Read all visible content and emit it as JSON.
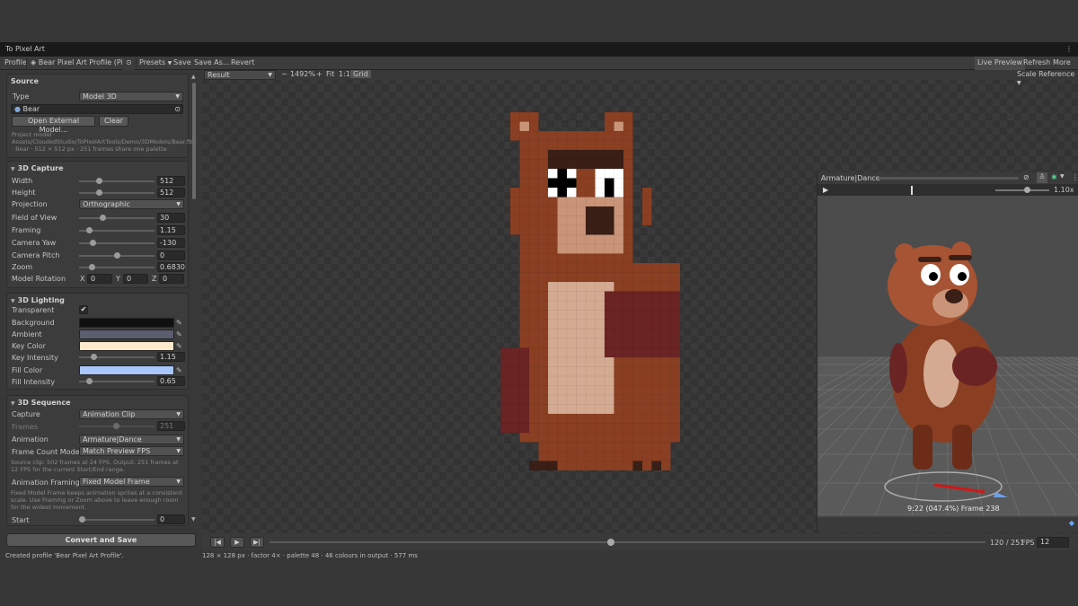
{
  "window": {
    "title": "To Pixel Art",
    "menu_icon": "vertical-dots-icon"
  },
  "toolbar": {
    "profile_label": "Profile",
    "profile_name": "Bear Pixel Art Profile (Pixel",
    "presets": "Presets",
    "save": "Save",
    "save_as": "Save As...",
    "revert": "Revert",
    "live_preview": "Live Preview",
    "refresh": "Refresh",
    "more": "More"
  },
  "source": {
    "title": "Source",
    "type_label": "Type",
    "type_value": "Model 3D",
    "model_value": "Bear",
    "open_external": "Open External Model...",
    "clear": "Clear",
    "info": "Project model · Assets/CloudedStudio/ToPixelArtTools/Demo/3DModels/Bear.fbx · Bear · 512 × 512 px · 251 frames share one palette"
  },
  "capture": {
    "title": "3D Capture",
    "rows": [
      {
        "label": "Width",
        "value": "512",
        "level": 0.25
      },
      {
        "label": "Height",
        "value": "512",
        "level": 0.25
      },
      {
        "label": "Field of View",
        "value": "30",
        "level": 0.3
      },
      {
        "label": "Framing",
        "value": "1.15",
        "level": 0.1
      },
      {
        "label": "Camera Yaw",
        "value": "-130",
        "level": 0.15
      },
      {
        "label": "Camera Pitch",
        "value": "0",
        "level": 0.5
      },
      {
        "label": "Zoom",
        "value": "0.6830",
        "level": 0.14
      }
    ],
    "projection_label": "Projection",
    "projection_value": "Orthographic",
    "rotation_label": "Model Rotation",
    "rot_x_label": "X",
    "rot_x": "0",
    "rot_y_label": "Y",
    "rot_y": "0",
    "rot_z_label": "Z",
    "rot_z": "0"
  },
  "lighting": {
    "title": "3D Lighting",
    "transparent_label": "Transparent",
    "transparent_checked": true,
    "colors": [
      {
        "label": "Background",
        "color": "#101010"
      },
      {
        "label": "Ambient",
        "color": "#5a5e6e"
      },
      {
        "label": "Key Color",
        "color": "#fde9cc"
      },
      {
        "label": "Fill Color",
        "color": "#a9c7fa"
      }
    ],
    "key_intensity_label": "Key Intensity",
    "key_intensity": "1.15",
    "key_level": 0.17,
    "fill_intensity_label": "Fill Intensity",
    "fill_intensity": "0.65",
    "fill_level": 0.1
  },
  "sequence": {
    "title": "3D Sequence",
    "capture_label": "Capture",
    "capture_value": "Animation Clip",
    "frames_label": "Frames",
    "frames_value": "251",
    "animation_label": "Animation",
    "animation_value": "Armature|Dance",
    "frame_count_label": "Frame Count Mode",
    "frame_count_value": "Match Preview FPS",
    "info1": "Source clip: 502 frames at 24 FPS. Output: 251 frames at 12 FPS for the current Start/End range.",
    "framing_label": "Animation Framing",
    "framing_value": "Fixed Model Frame",
    "info2": "Fixed Model Frame keeps animation sprites at a consistent scale. Use Framing or Zoom above to leave enough room for the widest movement.",
    "start_label": "Start",
    "start_value": "0"
  },
  "convert_button": "Convert and Save",
  "status_text": "Created profile 'Bear Pixel Art Profile'.",
  "viewport": {
    "view_mode": "Result",
    "minus": "−",
    "zoom": "1492%",
    "plus": "+",
    "fit": "Fit",
    "one_to_one": "1:1",
    "grid": "Grid",
    "scale_reference": "Scale Reference"
  },
  "preview": {
    "clip_name": "Armature|Dance",
    "speed": "1.10x",
    "timestamp": "9:22 (047.4%) Frame 238"
  },
  "playback": {
    "frame_counter": "120 / 251",
    "progress": 0.477,
    "fps_label": "FPS",
    "fps_value": "12"
  },
  "footer_text": "128 × 128 px · factor 4× · palette 48 · 46 colours in output · 577 ms",
  "bear_colors": {
    "fur": "#8a3f22",
    "fur_light": "#a65433",
    "fur_dark": "#6d2c17",
    "muzzle": "#c99477",
    "chest": "#d4ab92",
    "paw": "#6b2424",
    "nose": "#3a1f16"
  }
}
